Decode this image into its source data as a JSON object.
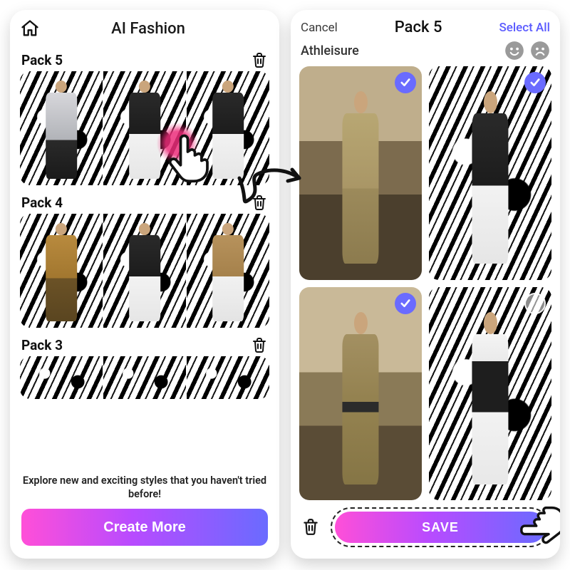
{
  "left": {
    "title": "AI Fashion",
    "packs": [
      {
        "name": "Pack 5"
      },
      {
        "name": "Pack 4"
      },
      {
        "name": "Pack 3"
      }
    ],
    "footer_message": "Explore new and exciting styles that you haven't tried before!",
    "create_button": "Create More"
  },
  "right": {
    "cancel": "Cancel",
    "title": "Pack 5",
    "select_all": "Select All",
    "category": "Athleisure",
    "tiles": [
      {
        "selected": true
      },
      {
        "selected": true
      },
      {
        "selected": true
      },
      {
        "selected": false
      }
    ],
    "save_button": "SAVE"
  },
  "icons": {
    "home": "home-icon",
    "trash": "trash-icon",
    "smile": "smile-icon",
    "frown": "frown-icon",
    "check": "check-icon"
  }
}
